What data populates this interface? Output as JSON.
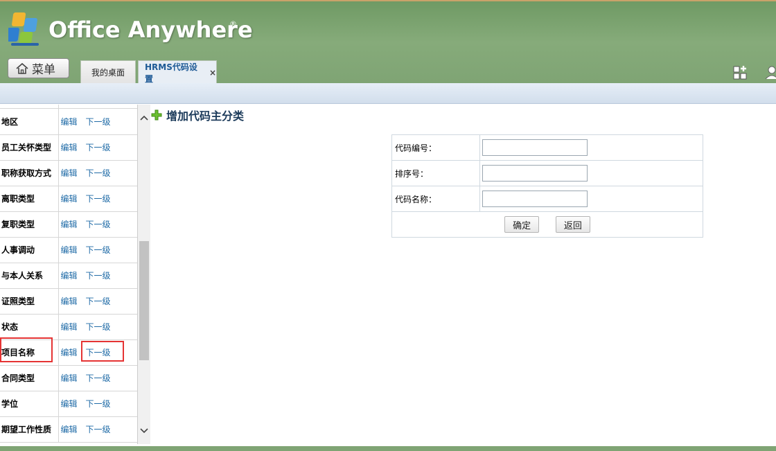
{
  "header": {
    "brand": "Office Anywhere",
    "brand_mark": "®",
    "menu_label": "菜单",
    "tabs": [
      {
        "label": "我的桌面"
      },
      {
        "label": "HRMS代码设置",
        "close": "×"
      }
    ],
    "colors": {
      "header_green": "#7fa474",
      "accent_blue": "#1e6aa6"
    }
  },
  "left_list": {
    "edit_label": "编辑",
    "sub_label": "下一级",
    "items": [
      {
        "name": "地区",
        "edit": "编辑",
        "sub": "下一级"
      },
      {
        "name": "员工关怀类型",
        "edit": "编辑",
        "sub": "下一级"
      },
      {
        "name": "职称获取方式",
        "edit": "编辑",
        "sub": "下一级"
      },
      {
        "name": "离职类型",
        "edit": "编辑",
        "sub": "下一级"
      },
      {
        "name": "复职类型",
        "edit": "编辑",
        "sub": "下一级"
      },
      {
        "name": "人事调动",
        "edit": "编辑",
        "sub": "下一级"
      },
      {
        "name": "与本人关系",
        "edit": "编辑",
        "sub": "下一级"
      },
      {
        "name": "证照类型",
        "edit": "编辑",
        "sub": "下一级"
      },
      {
        "name": "状态",
        "edit": "编辑",
        "sub": "下一级"
      },
      {
        "name": "项目名称",
        "edit": "编辑",
        "sub": "下一级"
      },
      {
        "name": "合同类型",
        "edit": "编辑",
        "sub": "下一级"
      },
      {
        "name": "学位",
        "edit": "编辑",
        "sub": "下一级"
      },
      {
        "name": "期望工作性质",
        "edit": "编辑",
        "sub": "下一级"
      }
    ]
  },
  "form": {
    "title": "增加代码主分类",
    "fields": [
      {
        "label": "代码编号：",
        "value": ""
      },
      {
        "label": "排序号：",
        "value": ""
      },
      {
        "label": "代码名称：",
        "value": ""
      }
    ],
    "confirm": "确定",
    "back": "返回"
  }
}
